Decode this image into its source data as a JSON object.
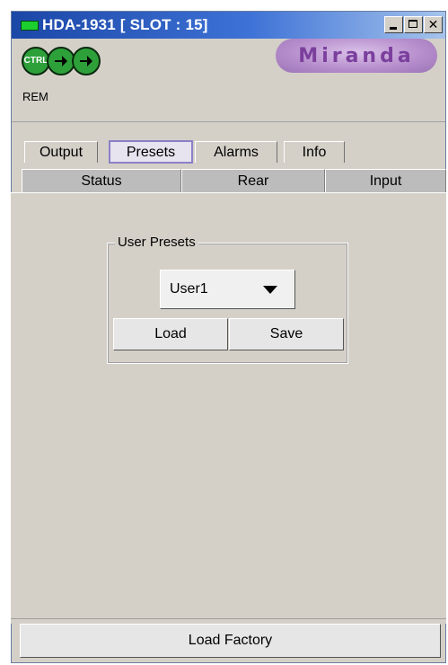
{
  "window": {
    "title": "HDA-1931 [ SLOT : 15]",
    "controls": [
      "minimize",
      "maximize",
      "close"
    ]
  },
  "header": {
    "status_icons": [
      "ctrl-icon",
      "arrow-icon",
      "arrow-icon"
    ],
    "ctrl_label": "CTRL",
    "rem_label": "REM",
    "logo_text": "Miranda"
  },
  "tabs_row1": [
    "Output",
    "Presets",
    "Alarms",
    "Info"
  ],
  "tabs_row1_active": "Presets",
  "tabs_row2": [
    "Status",
    "Rear",
    "Input"
  ],
  "presets": {
    "group_title": "User Presets",
    "selected": "User1",
    "load_label": "Load",
    "save_label": "Save"
  },
  "footer": {
    "load_factory_label": "Load Factory"
  },
  "colors": {
    "titlebar_start": "#1b47a7",
    "logo_text": "#7b3f9d",
    "status_green": "#2ea03a",
    "active_tab_border": "#8b80c8"
  }
}
